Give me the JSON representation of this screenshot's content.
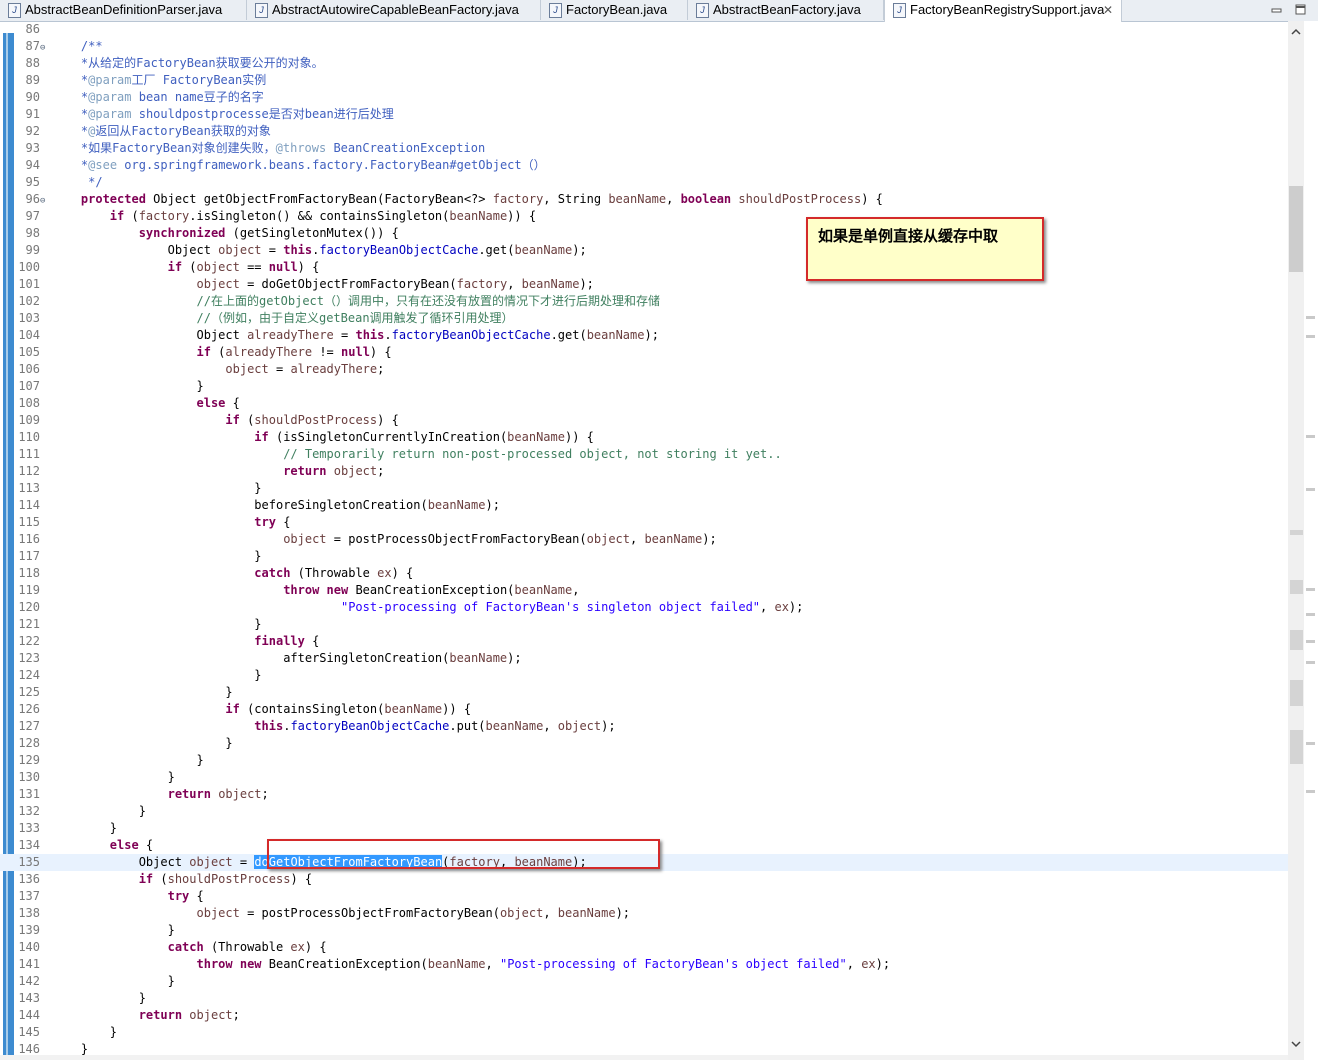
{
  "tabs": [
    {
      "label": "AbstractBeanDefinitionParser.java",
      "active": false
    },
    {
      "label": "AbstractAutowireCapableBeanFactory.java",
      "active": false
    },
    {
      "label": "FactoryBean.java",
      "active": false
    },
    {
      "label": "AbstractBeanFactory.java",
      "active": false
    },
    {
      "label": "FactoryBeanRegistrySupport.java",
      "active": true
    }
  ],
  "tab_close_glyph": "✕",
  "annotation_note": "如果是单例直接从缓存中取",
  "selected_method": "doGetObjectFromFactoryBean",
  "current_line": 135,
  "colors": {
    "keyword": "#7f0055",
    "javadoc": "#3f5fbf",
    "line_comment": "#3f7f5f",
    "string": "#2a00ff",
    "field": "#0000c0",
    "selection": "#3399ff",
    "annotation_border": "#d42a2a",
    "note_background": "#ffffc9"
  },
  "code_lines": [
    {
      "n": 86,
      "html": ""
    },
    {
      "n": 87,
      "fold": true,
      "html": "    <span class='cm'>/**</span>"
    },
    {
      "n": 88,
      "html": "    <span class='cm'>*<span class='zh'>从给定的</span>FactoryBean<span class='zh'>获取要公开的对象。</span></span>"
    },
    {
      "n": 89,
      "html": "    <span class='cm'>*<span class='an'>@param</span><span class='zh'>工厂</span> FactoryBean<span class='zh'>实例</span></span>"
    },
    {
      "n": 90,
      "html": "    <span class='cm'>*<span class='an'>@param</span> bean name<span class='zh'>豆子的名字</span></span>"
    },
    {
      "n": 91,
      "html": "    <span class='cm'>*<span class='an'>@param</span> shouldpostprocesse<span class='zh'>是否对</span>bean<span class='zh'>进行后处理</span></span>"
    },
    {
      "n": 92,
      "html": "    <span class='cm'>*<span class='an'>@</span><span class='zh'>返回从</span>FactoryBean<span class='zh'>获取的对象</span></span>"
    },
    {
      "n": 93,
      "html": "    <span class='cm'>*<span class='zh'>如果</span>FactoryBean<span class='zh'>对象创建失败，</span><span class='an'>@throws</span> BeanCreationException</span>"
    },
    {
      "n": 94,
      "html": "    <span class='cm'>*<span class='an'>@see</span> org.springframework.beans.factory.FactoryBean#getObject<span class='zh'>（）</span></span>"
    },
    {
      "n": 95,
      "html": "     <span class='cm'>*/</span>"
    },
    {
      "n": 96,
      "fold": true,
      "html": "    <span class='kw'>protected</span> Object getObjectFromFactoryBean(FactoryBean&lt;?&gt; <span class='vr'>factory</span>, String <span class='vr'>beanName</span>, <span class='kw'>boolean</span> <span class='vr'>shouldPostProcess</span>) {"
    },
    {
      "n": 97,
      "html": "        <span class='kw'>if</span> (<span class='vr'>factory</span>.isSingleton() &amp;&amp; containsSingleton(<span class='vr'>beanName</span>)) {"
    },
    {
      "n": 98,
      "html": "            <span class='kw'>synchronized</span> (getSingletonMutex()) {"
    },
    {
      "n": 99,
      "html": "                Object <span class='vr'>object</span> = <span class='kw'>this</span>.<span class='fd'>factoryBeanObjectCache</span>.get(<span class='vr'>beanName</span>);"
    },
    {
      "n": 100,
      "html": "                <span class='kw'>if</span> (<span class='vr'>object</span> == <span class='kw'>null</span>) {"
    },
    {
      "n": 101,
      "html": "                    <span class='vr'>object</span> = doGetObjectFromFactoryBean(<span class='vr'>factory</span>, <span class='vr'>beanName</span>);"
    },
    {
      "n": 102,
      "html": "                    <span class='lc'>//<span class='zh'>在上面的</span>getObject<span class='zh'>（）调用中，只有在还没有放置的情况下才进行后期处理和存储</span></span>"
    },
    {
      "n": 103,
      "html": "                    <span class='lc'>//<span class='zh'>（例如，由于自定义</span>getBean<span class='zh'>调用触发了循环引用处理）</span></span>"
    },
    {
      "n": 104,
      "html": "                    Object <span class='vr'>alreadyThere</span> = <span class='kw'>this</span>.<span class='fd'>factoryBeanObjectCache</span>.get(<span class='vr'>beanName</span>);"
    },
    {
      "n": 105,
      "html": "                    <span class='kw'>if</span> (<span class='vr'>alreadyThere</span> != <span class='kw'>null</span>) {"
    },
    {
      "n": 106,
      "html": "                        <span class='vr'>object</span> = <span class='vr'>alreadyThere</span>;"
    },
    {
      "n": 107,
      "html": "                    }"
    },
    {
      "n": 108,
      "html": "                    <span class='kw'>else</span> {"
    },
    {
      "n": 109,
      "html": "                        <span class='kw'>if</span> (<span class='vr'>shouldPostProcess</span>) {"
    },
    {
      "n": 110,
      "html": "                            <span class='kw'>if</span> (isSingletonCurrentlyInCreation(<span class='vr'>beanName</span>)) {"
    },
    {
      "n": 111,
      "html": "                                <span class='lc'>// Temporarily return non-post-processed object, not storing it yet..</span>"
    },
    {
      "n": 112,
      "html": "                                <span class='kw'>return</span> <span class='vr'>object</span>;"
    },
    {
      "n": 113,
      "html": "                            }"
    },
    {
      "n": 114,
      "html": "                            beforeSingletonCreation(<span class='vr'>beanName</span>);"
    },
    {
      "n": 115,
      "html": "                            <span class='kw'>try</span> {"
    },
    {
      "n": 116,
      "html": "                                <span class='vr'>object</span> = postProcessObjectFromFactoryBean(<span class='vr'>object</span>, <span class='vr'>beanName</span>);"
    },
    {
      "n": 117,
      "html": "                            }"
    },
    {
      "n": 118,
      "html": "                            <span class='kw'>catch</span> (Throwable <span class='vr'>ex</span>) {"
    },
    {
      "n": 119,
      "html": "                                <span class='kw'>throw</span> <span class='kw'>new</span> BeanCreationException(<span class='vr'>beanName</span>,"
    },
    {
      "n": 120,
      "html": "                                        <span class='st'>\"Post-processing of FactoryBean's singleton object failed\"</span>, <span class='vr'>ex</span>);"
    },
    {
      "n": 121,
      "html": "                            }"
    },
    {
      "n": 122,
      "html": "                            <span class='kw'>finally</span> {"
    },
    {
      "n": 123,
      "html": "                                afterSingletonCreation(<span class='vr'>beanName</span>);"
    },
    {
      "n": 124,
      "html": "                            }"
    },
    {
      "n": 125,
      "html": "                        }"
    },
    {
      "n": 126,
      "html": "                        <span class='kw'>if</span> (containsSingleton(<span class='vr'>beanName</span>)) {"
    },
    {
      "n": 127,
      "html": "                            <span class='kw'>this</span>.<span class='fd'>factoryBeanObjectCache</span>.put(<span class='vr'>beanName</span>, <span class='vr'>object</span>);"
    },
    {
      "n": 128,
      "html": "                        }"
    },
    {
      "n": 129,
      "html": "                    }"
    },
    {
      "n": 130,
      "html": "                }"
    },
    {
      "n": 131,
      "html": "                <span class='kw'>return</span> <span class='vr'>object</span>;"
    },
    {
      "n": 132,
      "html": "            }"
    },
    {
      "n": 133,
      "html": "        }"
    },
    {
      "n": 134,
      "html": "        <span class='kw'>else</span> {"
    },
    {
      "n": 135,
      "current": true,
      "html": "            Object <span class='vr'>object</span> = <span class='sel'>doGetObjectFromFactoryBean</span>(<span class='vr'>factory</span>, <span class='vr'>beanName</span>);"
    },
    {
      "n": 136,
      "html": "            <span class='kw'>if</span> (<span class='vr'>shouldPostProcess</span>) {"
    },
    {
      "n": 137,
      "html": "                <span class='kw'>try</span> {"
    },
    {
      "n": 138,
      "html": "                    <span class='vr'>object</span> = postProcessObjectFromFactoryBean(<span class='vr'>object</span>, <span class='vr'>beanName</span>);"
    },
    {
      "n": 139,
      "html": "                }"
    },
    {
      "n": 140,
      "html": "                <span class='kw'>catch</span> (Throwable <span class='vr'>ex</span>) {"
    },
    {
      "n": 141,
      "html": "                    <span class='kw'>throw</span> <span class='kw'>new</span> BeanCreationException(<span class='vr'>beanName</span>, <span class='st'>\"Post-processing of FactoryBean's object failed\"</span>, <span class='vr'>ex</span>);"
    },
    {
      "n": 142,
      "html": "                }"
    },
    {
      "n": 143,
      "html": "            }"
    },
    {
      "n": 144,
      "html": "            <span class='kw'>return</span> <span class='vr'>object</span>;"
    },
    {
      "n": 145,
      "html": "        }"
    },
    {
      "n": 146,
      "html": "    }"
    }
  ]
}
